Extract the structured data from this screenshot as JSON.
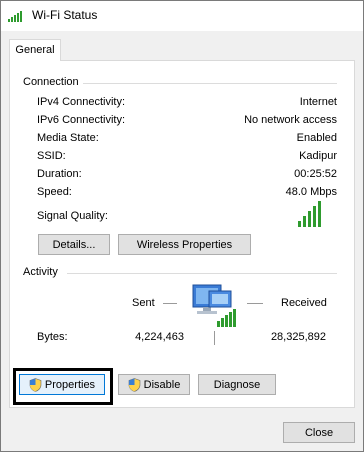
{
  "window": {
    "title": "Wi-Fi Status"
  },
  "tabs": [
    {
      "label": "General",
      "selected": true
    }
  ],
  "connection": {
    "heading": "Connection",
    "rows": [
      {
        "label": "IPv4 Connectivity:",
        "value": "Internet"
      },
      {
        "label": "IPv6 Connectivity:",
        "value": "No network access"
      },
      {
        "label": "Media State:",
        "value": "Enabled"
      },
      {
        "label": "SSID:",
        "value": "Kadipur"
      },
      {
        "label": "Duration:",
        "value": "00:25:52"
      },
      {
        "label": "Speed:",
        "value": "48.0 Mbps"
      }
    ],
    "signal_quality_label": "Signal Quality:",
    "signal_quality_bars": 5,
    "details_button": "Details...",
    "wireless_properties_button": "Wireless Properties"
  },
  "activity": {
    "heading": "Activity",
    "sent_label": "Sent",
    "received_label": "Received",
    "bytes_label": "Bytes:",
    "bytes_sent": "4,224,463",
    "bytes_received": "28,325,892"
  },
  "actions": {
    "properties_button": "Properties",
    "disable_button": "Disable",
    "diagnose_button": "Diagnose"
  },
  "footer": {
    "close_button": "Close"
  },
  "icons": {
    "title": "wifi-signal-icon",
    "shield": "uac-shield-icon",
    "network": "network-computer-icon"
  },
  "colors": {
    "signal_green": "#2e9b2e",
    "focus_blue": "#0078d7"
  }
}
